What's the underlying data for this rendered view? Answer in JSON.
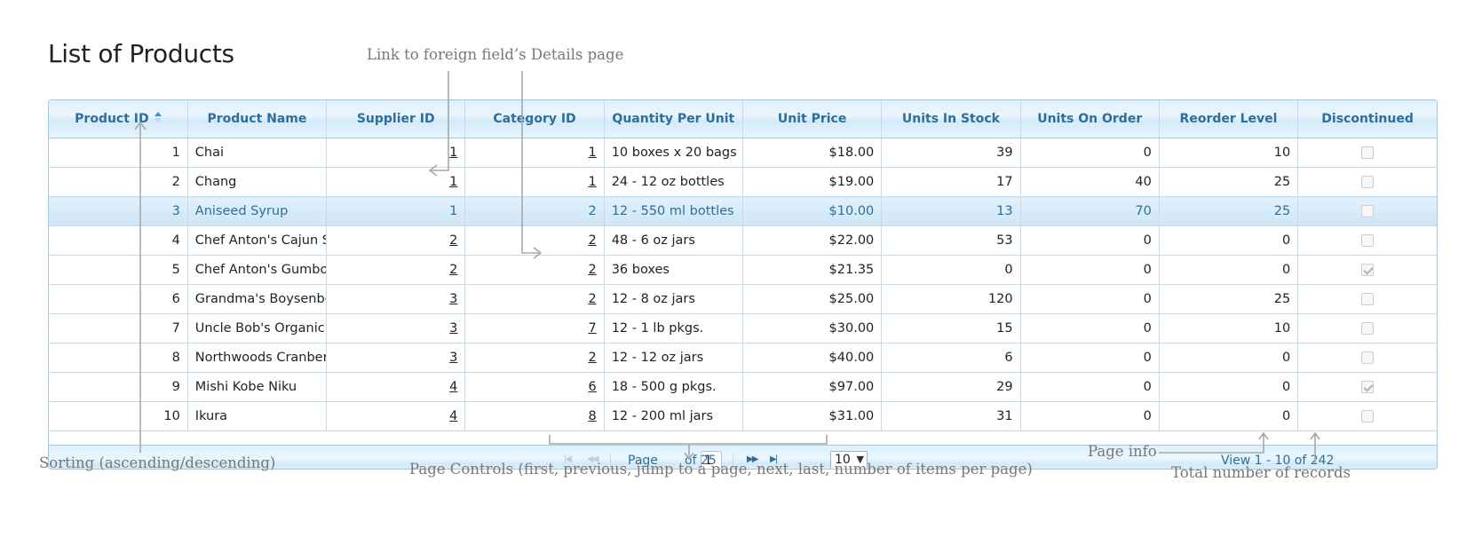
{
  "page": {
    "title": "List of Products"
  },
  "columns": [
    "Product ID",
    "Product Name",
    "Supplier ID",
    "Category ID",
    "Quantity Per Unit",
    "Unit Price",
    "Units In Stock",
    "Units On Order",
    "Reorder Level",
    "Discontinued"
  ],
  "rows": [
    {
      "id": "1",
      "name": "Chai",
      "supplier": "1",
      "category": "1",
      "qty": "10 boxes x 20 bags",
      "price": "$18.00",
      "stock": "39",
      "order": "0",
      "reorder": "10",
      "disc": false
    },
    {
      "id": "2",
      "name": "Chang",
      "supplier": "1",
      "category": "1",
      "qty": "24 - 12 oz bottles",
      "price": "$19.00",
      "stock": "17",
      "order": "40",
      "reorder": "25",
      "disc": false
    },
    {
      "id": "3",
      "name": "Aniseed Syrup",
      "supplier": "1",
      "category": "2",
      "qty": "12 - 550 ml bottles",
      "price": "$10.00",
      "stock": "13",
      "order": "70",
      "reorder": "25",
      "disc": false,
      "selected": true
    },
    {
      "id": "4",
      "name": "Chef Anton's Cajun S",
      "supplier": "2",
      "category": "2",
      "qty": "48 - 6 oz jars",
      "price": "$22.00",
      "stock": "53",
      "order": "0",
      "reorder": "0",
      "disc": false
    },
    {
      "id": "5",
      "name": "Chef Anton's Gumbo",
      "supplier": "2",
      "category": "2",
      "qty": "36 boxes",
      "price": "$21.35",
      "stock": "0",
      "order": "0",
      "reorder": "0",
      "disc": true
    },
    {
      "id": "6",
      "name": "Grandma's Boysenbe",
      "supplier": "3",
      "category": "2",
      "qty": "12 - 8 oz jars",
      "price": "$25.00",
      "stock": "120",
      "order": "0",
      "reorder": "25",
      "disc": false
    },
    {
      "id": "7",
      "name": "Uncle Bob's Organic",
      "supplier": "3",
      "category": "7",
      "qty": "12 - 1 lb pkgs.",
      "price": "$30.00",
      "stock": "15",
      "order": "0",
      "reorder": "10",
      "disc": false
    },
    {
      "id": "8",
      "name": "Northwoods Cranber",
      "supplier": "3",
      "category": "2",
      "qty": "12 - 12 oz jars",
      "price": "$40.00",
      "stock": "6",
      "order": "0",
      "reorder": "0",
      "disc": false
    },
    {
      "id": "9",
      "name": "Mishi Kobe Niku",
      "supplier": "4",
      "category": "6",
      "qty": "18 - 500 g pkgs.",
      "price": "$97.00",
      "stock": "29",
      "order": "0",
      "reorder": "0",
      "disc": true
    },
    {
      "id": "10",
      "name": "Ikura",
      "supplier": "4",
      "category": "8",
      "qty": "12 - 200 ml jars",
      "price": "$31.00",
      "stock": "31",
      "order": "0",
      "reorder": "0",
      "disc": false
    }
  ],
  "pager": {
    "page_label": "Page",
    "current_page": "1",
    "of_label": "of 25",
    "page_size": "10",
    "view_info": "View 1 - 10 of 242"
  },
  "annotations": {
    "link": "Link to foreign field’s Details page",
    "sorting": "Sorting (ascending/descending)",
    "page_controls": "Page Controls (first, previous, jump to a page, next, last, number of items per page)",
    "page_info": "Page info",
    "total": "Total number of records"
  },
  "colors": {
    "header_text": "#2e6e9e",
    "border": "#a6c9e2",
    "annotation": "#777777"
  }
}
